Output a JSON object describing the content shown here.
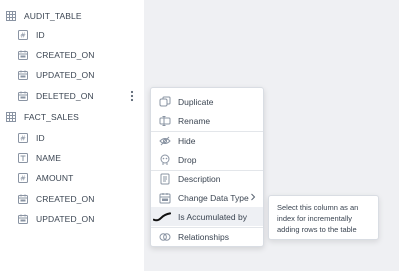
{
  "tree": {
    "tables": [
      {
        "name": "AUDIT_TABLE",
        "columns": [
          {
            "name": "ID",
            "type_icon": "hash-icon"
          },
          {
            "name": "CREATED_ON",
            "type_icon": "calendar-icon"
          },
          {
            "name": "UPDATED_ON",
            "type_icon": "calendar-icon"
          },
          {
            "name": "DELETED_ON",
            "type_icon": "calendar-icon"
          }
        ]
      },
      {
        "name": "FACT_SALES",
        "columns": [
          {
            "name": "ID",
            "type_icon": "hash-icon"
          },
          {
            "name": "NAME",
            "type_icon": "text-icon"
          },
          {
            "name": "AMOUNT",
            "type_icon": "hash-icon"
          },
          {
            "name": "CREATED_ON",
            "type_icon": "calendar-icon"
          },
          {
            "name": "UPDATED_ON",
            "type_icon": "calendar-icon"
          }
        ]
      }
    ]
  },
  "context_menu": {
    "items": [
      {
        "label": "Duplicate",
        "icon": "duplicate-icon"
      },
      {
        "label": "Rename",
        "icon": "rename-icon"
      },
      {
        "label": "Hide",
        "icon": "eye-off-icon"
      },
      {
        "label": "Drop",
        "icon": "drop-icon"
      },
      {
        "label": "Description",
        "icon": "description-icon"
      },
      {
        "label": "Change Data Type",
        "icon": "calendar-icon"
      },
      {
        "label": "Is Accumulated by",
        "icon": "accumulated-icon"
      },
      {
        "label": "Relationships",
        "icon": "relationships-icon"
      }
    ]
  },
  "tooltip": {
    "text": "Select this column as an index for incrementally adding rows to the table"
  },
  "colors": {
    "sidebar_bg": "#ffffff",
    "canvas_bg": "#eff0f3",
    "text": "#3b4552",
    "icon": "#8a94a3",
    "highlight": "#eef0f4"
  }
}
